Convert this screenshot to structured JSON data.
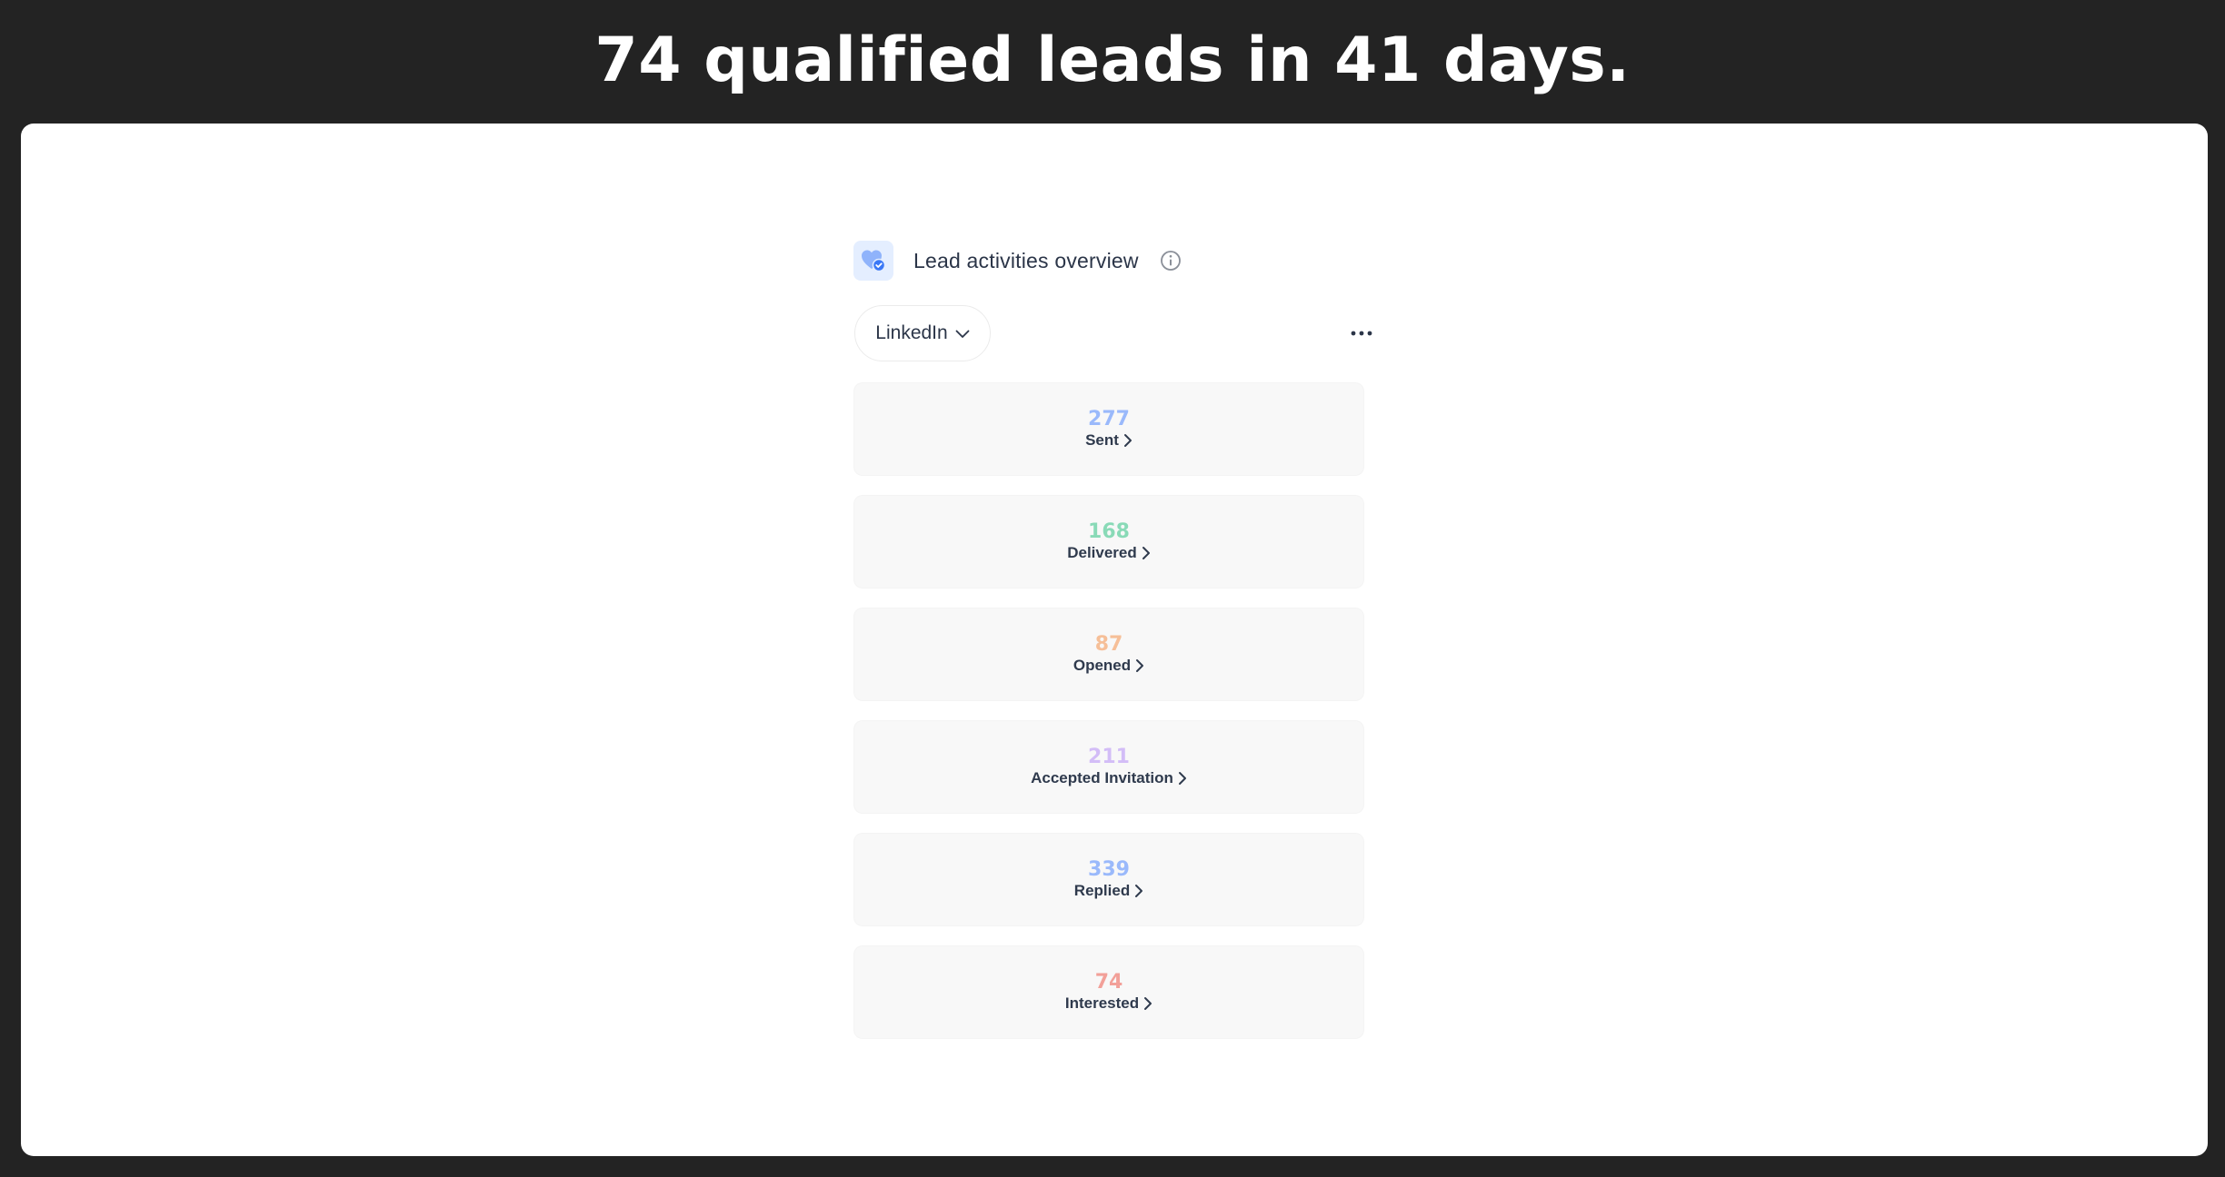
{
  "headline": "74 qualified leads in 41 days.",
  "widget": {
    "title": "Lead activities overview",
    "icon": "heart-check-icon",
    "info_icon": "info-icon",
    "channel": "LinkedIn",
    "more_icon": "more-horizontal-icon"
  },
  "metrics": [
    {
      "value": "277",
      "label": "Sent",
      "color": "#4f86ff"
    },
    {
      "value": "168",
      "label": "Delivered",
      "color": "#2fc283"
    },
    {
      "value": "87",
      "label": "Opened",
      "color": "#f5914a"
    },
    {
      "value": "211",
      "label": "Accepted Invitation",
      "color": "#b58ef7"
    },
    {
      "value": "339",
      "label": "Replied",
      "color": "#4f86ff"
    },
    {
      "value": "74",
      "label": "Interested",
      "color": "#ee5a4c"
    }
  ],
  "colors": {
    "page_background": "#232323",
    "canvas": "#ffffff",
    "card": "#f8f8f8",
    "icon_accent": "#3b78f6"
  }
}
